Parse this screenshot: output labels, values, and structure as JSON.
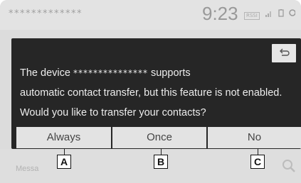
{
  "status_bar": {
    "device_name": "*************",
    "clock": "9:23",
    "rssi_label": "RSSI"
  },
  "dialog": {
    "line1_prefix": "The device ",
    "line1_masked": "***************",
    "line1_suffix": " supports",
    "line2": "automatic contact transfer, but this feature is not enabled.",
    "line3": "Would you like to transfer your contacts?",
    "buttons": {
      "always": "Always",
      "once": "Once",
      "no": "No"
    }
  },
  "background": {
    "message_hint": "Messa"
  },
  "callouts": [
    "A",
    "B",
    "C"
  ],
  "colors": {
    "dialog_bg": "#262626",
    "dialog_text": "#ededed",
    "button_bg": "#e3e3e3"
  }
}
